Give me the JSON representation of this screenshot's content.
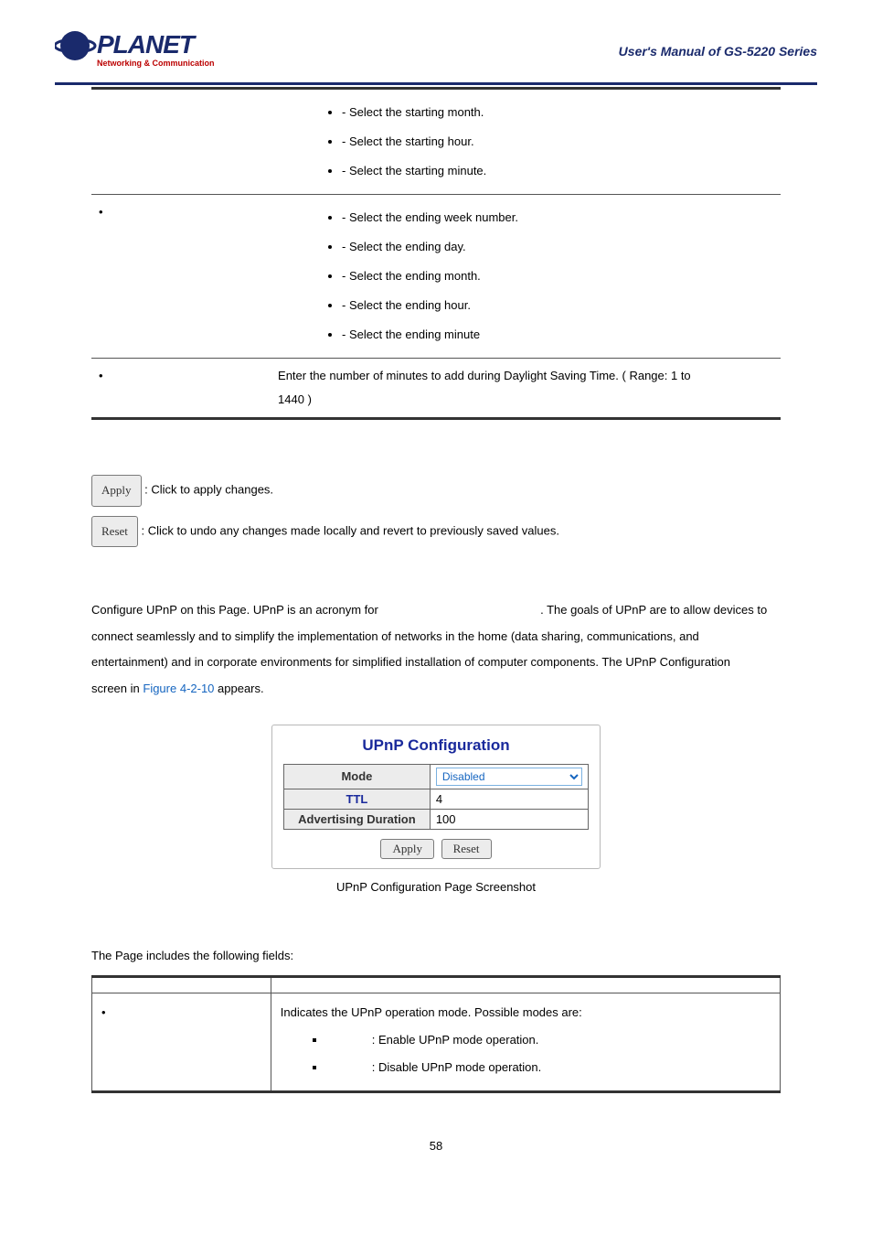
{
  "header": {
    "brand_main": "PLANET",
    "brand_sub": "Networking & Communication",
    "manual_title": "User's  Manual  of  GS-5220  Series"
  },
  "table1": {
    "row1_items": [
      "- Select the starting month.",
      "- Select the starting hour.",
      "- Select the starting minute."
    ],
    "row2_items": [
      "- Select the ending week number.",
      "- Select the ending day.",
      "- Select the ending month.",
      "- Select the ending hour.",
      "- Select the ending minute"
    ],
    "row3_text_a": "Enter the number of minutes to add during Daylight Saving Time. ( Range: 1 to",
    "row3_text_b": "1440 )"
  },
  "buttons": {
    "apply_label": "Apply",
    "apply_desc": ": Click to apply changes.",
    "reset_label": "Reset",
    "reset_desc": ": Click to undo any changes made locally and revert to previously saved values."
  },
  "upnp_section": {
    "para_a": "Configure UPnP on this Page. UPnP is an acronym for ",
    "para_b": ". The goals of UPnP are to allow devices to",
    "para_c": "connect seamlessly and to simplify the implementation of networks in the home (data sharing, communications, and",
    "para_d": "entertainment) and in corporate environments for simplified installation of computer components. The UPnP Configuration",
    "para_e": "screen in ",
    "fig_ref": "Figure 4-2-10",
    "para_f": " appears."
  },
  "upnp_panel": {
    "title": "UPnP Configuration",
    "mode_label": "Mode",
    "mode_value": "Disabled",
    "ttl_label": "TTL",
    "ttl_value": "4",
    "adv_label": "Advertising Duration",
    "adv_value": "100",
    "apply": "Apply",
    "reset": "Reset"
  },
  "fig_caption": "UPnP Configuration Page Screenshot",
  "fields_intro": "The Page includes the following fields:",
  "table2": {
    "col_object": "",
    "col_desc": "",
    "mode_desc": "Indicates the UPnP operation mode. Possible modes are:",
    "mode_enabled": ": Enable UPnP mode operation.",
    "mode_disabled": ": Disable UPnP mode operation."
  },
  "page_number": "58"
}
